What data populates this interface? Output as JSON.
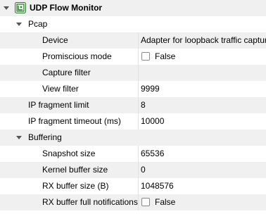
{
  "root": {
    "title": "UDP Flow Monitor",
    "icon": "plugin-icon"
  },
  "pcap": {
    "label": "Pcap",
    "device": {
      "label": "Device",
      "value": "Adapter for loopback traffic capture -"
    },
    "promiscuous": {
      "label": "Promiscious mode",
      "value": "False",
      "checked": false
    },
    "capture_filter": {
      "label": "Capture filter",
      "value": ""
    },
    "view_filter": {
      "label": "View filter",
      "value": "9999"
    }
  },
  "ip_fragment_limit": {
    "label": "IP fragment limit",
    "value": "8"
  },
  "ip_fragment_timeout": {
    "label": "IP fragment timeout (ms)",
    "value": "10000"
  },
  "buffering": {
    "label": "Buffering",
    "snapshot_size": {
      "label": "Snapshot size",
      "value": "65536"
    },
    "kernel_buffer_size": {
      "label": "Kernel buffer size",
      "value": "0"
    },
    "rx_buffer_size": {
      "label": "RX buffer size (B)",
      "value": "1048576"
    },
    "rx_buffer_full_notifications": {
      "label": "RX buffer full notifications",
      "value": "False",
      "checked": false
    }
  },
  "colors": {
    "alt_row": "#f0f0f0",
    "icon_green": "#2f7a2f",
    "arrow": "#555555"
  }
}
